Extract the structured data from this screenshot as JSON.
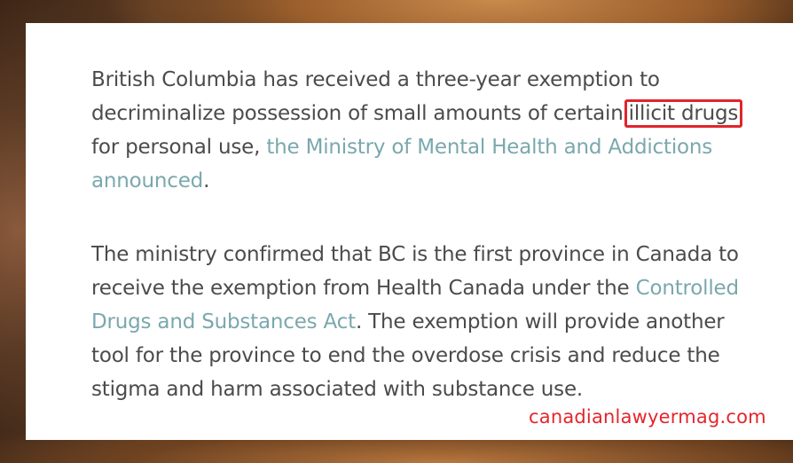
{
  "article": {
    "paragraph1": {
      "text_before": "British Columbia has received a three-year exemption to decriminalize possession of small amounts of certain",
      "highlighted": "illicit drugs",
      "text_middle": " for personal use, ",
      "link": "the Ministry of Mental Health and Addictions announced",
      "text_after": "."
    },
    "paragraph2": {
      "text_before": "The ministry confirmed that BC is the first province in Canada to receive the exemption from Health Canada under the ",
      "link": "Controlled Drugs and Substances Act",
      "text_after": ". The exemption will provide another tool for the province to end the overdose crisis and reduce the stigma and harm associated with substance use."
    }
  },
  "watermark": "canadianlawyermag.com",
  "colors": {
    "body_text": "#4b4b4b",
    "link": "#7aa8ad",
    "highlight_border": "#e0252b",
    "watermark": "#e3262c"
  }
}
